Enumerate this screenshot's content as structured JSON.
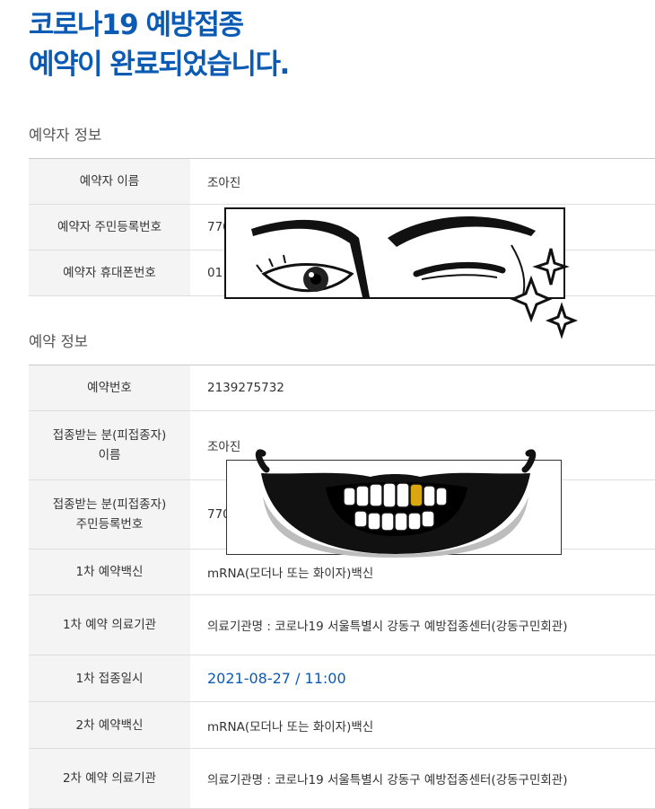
{
  "page": {
    "title_line1": "코로나19 예방접종",
    "title_line2": "예약이 완료되었습니다."
  },
  "booker_section": {
    "title": "예약자 정보",
    "rows": [
      {
        "label": "예약자 이름",
        "value": "조아진"
      },
      {
        "label": "예약자 주민등록번호",
        "value": "770"
      },
      {
        "label": "예약자 휴대폰번호",
        "value": "01"
      }
    ]
  },
  "reservation_section": {
    "title": "예약 정보",
    "rows": [
      {
        "label": "예약번호",
        "value": "2139275732"
      },
      {
        "label_line1": "접종받는 분(피접종자)",
        "label_line2": "이름",
        "value": "조아진"
      },
      {
        "label_line1": "접종받는 분(피접종자)",
        "label_line2": "주민등록번호",
        "value": "770"
      },
      {
        "label": "1차 예약백신",
        "value": "mRNA(모더나 또는 화이자)백신"
      },
      {
        "label": "1차 예약 의료기관",
        "value": "의료기관명 : 코로나19 서울특별시 강동구 예방접종센터(강동구민회관)"
      },
      {
        "label": "1차 접종일시",
        "value": "2021-08-27 / 11:00"
      },
      {
        "label": "2차 예약백신",
        "value": "mRNA(모더나 또는 화이자)백신"
      },
      {
        "label": "2차 예약 의료기관",
        "value": "의료기관명 : 코로나19 서울특별시 강동구 예방접종센터(강동구민회관)"
      }
    ]
  },
  "overlays": {
    "eyes": "winking-eyes-sticker",
    "mouth": "grinning-mouth-sticker",
    "gold_tooth_color": "#d9a80f"
  },
  "colors": {
    "accent": "#0b5bb5",
    "header_cell_bg": "#f4f4f4"
  }
}
